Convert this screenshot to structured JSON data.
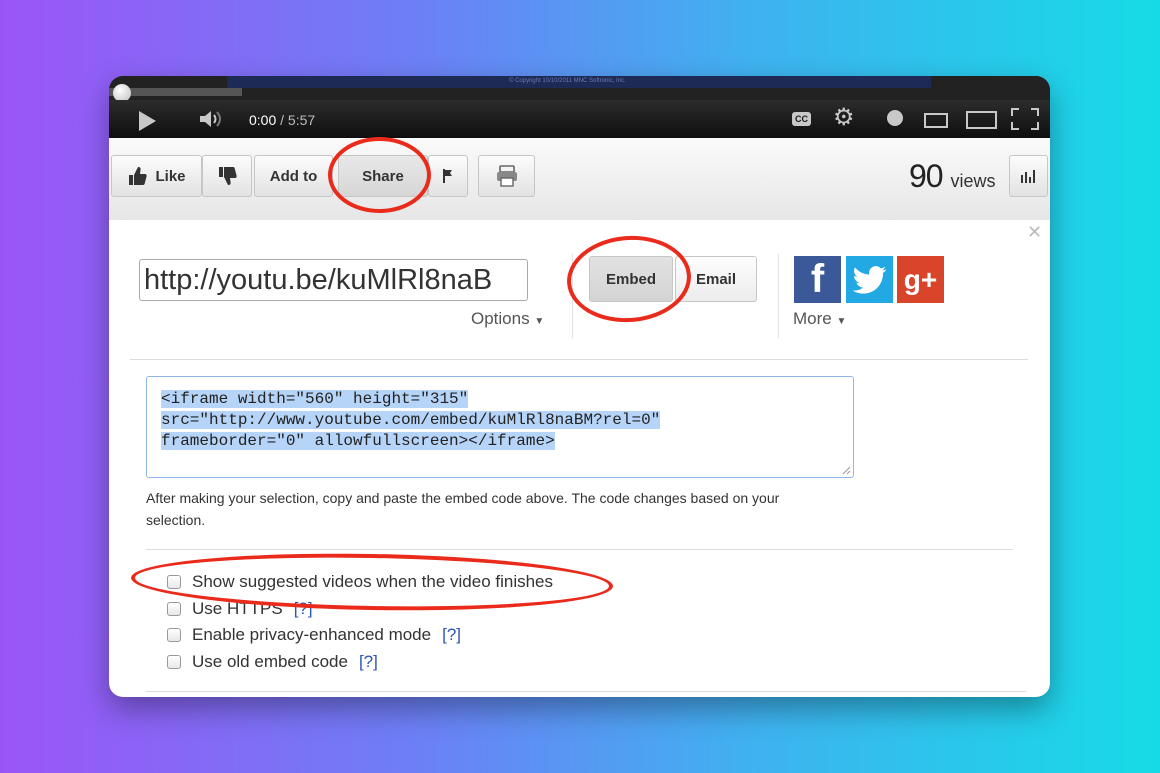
{
  "player": {
    "copyright": "© Copyright 10/10/2011 MNC Softronic, Inc.",
    "time_current": "0:00",
    "time_duration": "/ 5:57",
    "cc_label": "CC"
  },
  "actions": {
    "like": "Like",
    "add_to": "Add to",
    "share": "Share",
    "views_count": "90",
    "views_label": "views"
  },
  "share": {
    "url": "http://youtu.be/kuMlRl8naB",
    "options": "Options",
    "tabs": [
      "Embed",
      "Email"
    ],
    "more": "More",
    "social": [
      "f",
      "twitter",
      "g+"
    ],
    "embed_code": [
      "<iframe width=\"560\" height=\"315\"",
      "src=\"http://www.youtube.com/embed/kuMlRl8naBM?rel=0\"",
      "frameborder=\"0\" allowfullscreen></iframe>"
    ],
    "help_text": "After making your selection, copy and paste the embed code above. The code changes based on your selection.",
    "checkboxes": [
      {
        "label": "Show suggested videos when the video finishes",
        "help": ""
      },
      {
        "label": "Use HTTPS",
        "help": "[?]"
      },
      {
        "label": "Enable privacy-enhanced mode",
        "help": "[?]"
      },
      {
        "label": "Use old embed code",
        "help": "[?]"
      }
    ]
  },
  "colors": {
    "annotation_red": "#ea2a1a",
    "link_blue": "#2b55b6",
    "selection_blue": "#b6d4f8"
  }
}
